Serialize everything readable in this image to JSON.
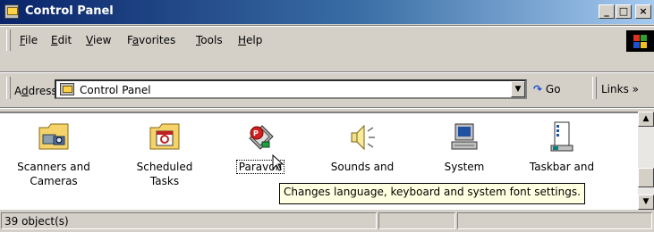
{
  "window": {
    "title": "Control Panel",
    "buttons": {
      "minimize": "_",
      "maximize": "□",
      "close": "×"
    }
  },
  "menubar": {
    "items": [
      {
        "key": "F",
        "rest": "ile"
      },
      {
        "key": "E",
        "rest": "dit"
      },
      {
        "key": "V",
        "rest": "iew"
      },
      {
        "pre": "F",
        "key": "a",
        "rest": "vorites"
      },
      {
        "key": "T",
        "rest": "ools"
      },
      {
        "key": "H",
        "rest": "elp"
      }
    ]
  },
  "address": {
    "label_pre": "A",
    "label_key": "d",
    "label_rest": "dress",
    "value": "Control Panel",
    "go_label": "Go",
    "links_label": "Links »"
  },
  "items": [
    {
      "line1": "Scanners and",
      "line2": "Cameras",
      "icon": "scanner-camera-icon"
    },
    {
      "line1": "Scheduled",
      "line2": "Tasks",
      "icon": "scheduled-tasks-icon"
    },
    {
      "line1": "Paravon",
      "line2": "",
      "icon": "paravon-icon"
    },
    {
      "line1": "Sounds and",
      "line2": "",
      "icon": "sounds-icon"
    },
    {
      "line1": "System",
      "line2": "",
      "icon": "system-icon"
    },
    {
      "line1": "Taskbar and",
      "line2": "",
      "icon": "taskbar-icon"
    }
  ],
  "tooltip": "Changes language, keyboard and system font settings.",
  "status": {
    "count": "39 object(s)"
  }
}
